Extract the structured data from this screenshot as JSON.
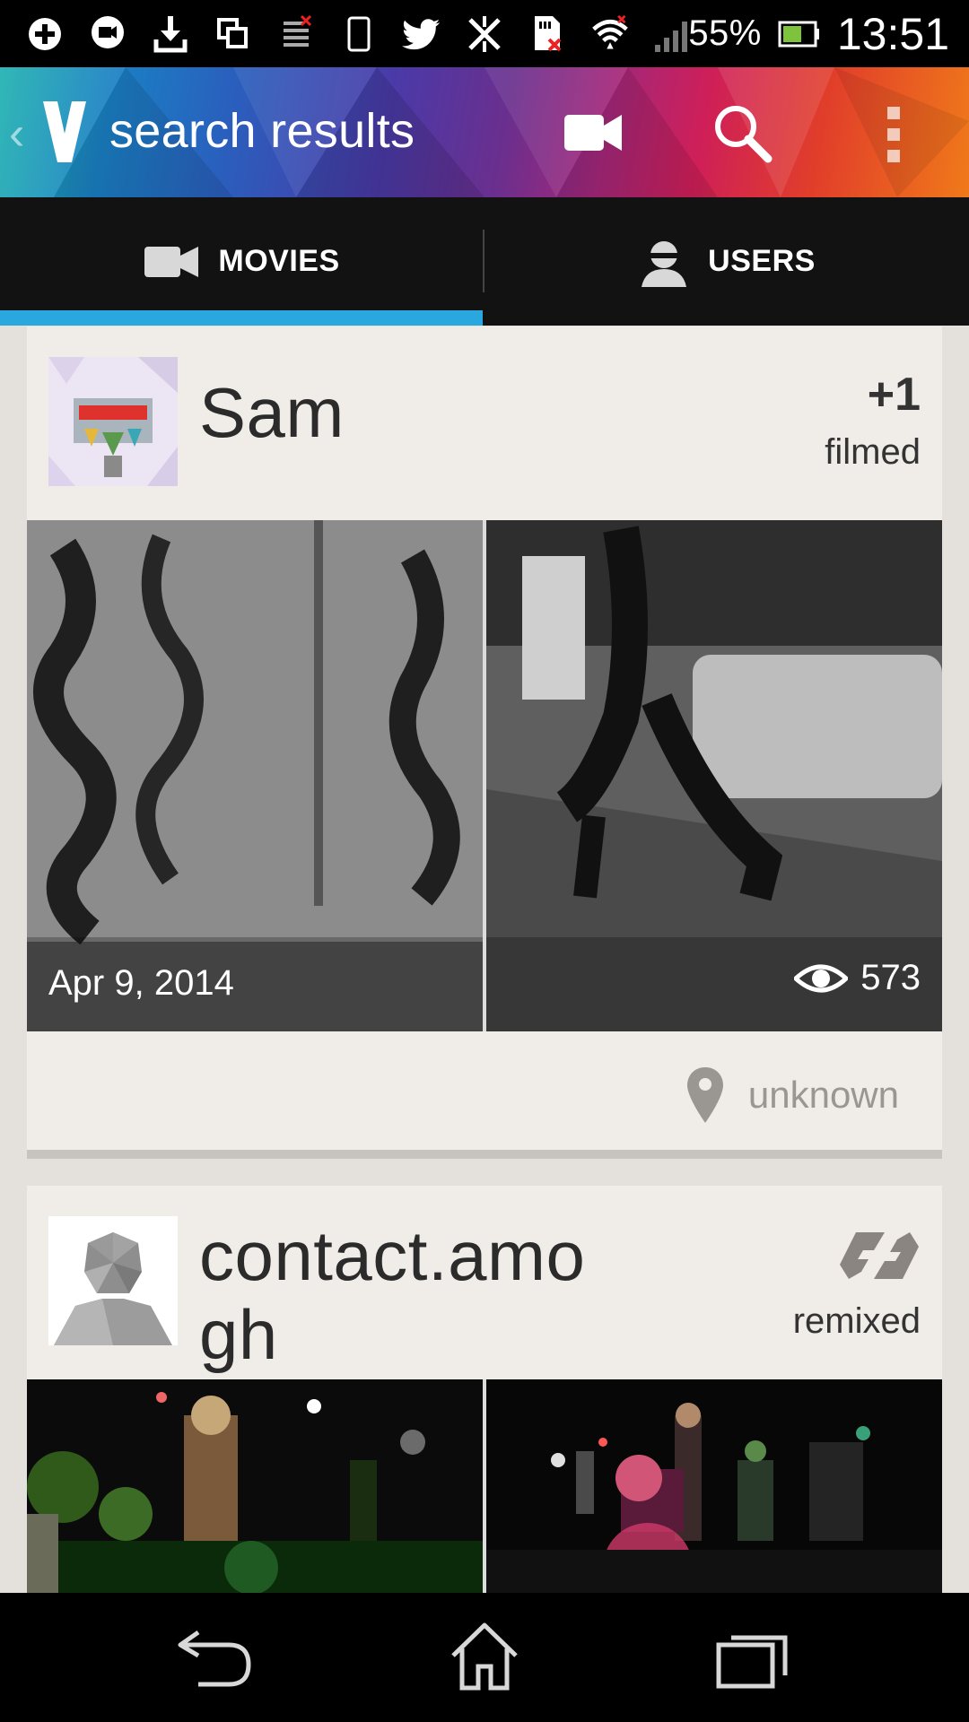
{
  "status_bar": {
    "icons": [
      "add-box-icon",
      "message-icon",
      "download-icon",
      "copy-icon",
      "sim-off-icon",
      "phone-outline-icon",
      "twitter-icon",
      "data-off-icon",
      "sd-card-error-icon",
      "wifi-icon",
      "signal-icon"
    ],
    "battery_pct": "55%",
    "time": "13:51"
  },
  "action_bar": {
    "title": "search results",
    "icons": [
      "back-icon",
      "app-logo",
      "video-camera-icon",
      "search-icon",
      "overflow-menu-icon"
    ]
  },
  "tabs": [
    {
      "label": "MOVIES",
      "icon": "video-camera-icon",
      "selected": true
    },
    {
      "label": "USERS",
      "icon": "user-icon",
      "selected": false
    }
  ],
  "accent_color": "#2aa7de",
  "results": [
    {
      "user": "Sam",
      "stat_top": "+1",
      "stat_label": "filmed",
      "date": "Apr 9, 2014",
      "views": "573",
      "location": "unknown"
    },
    {
      "user_line1": "contact.amo",
      "user_line2": "gh",
      "stat_label": "remixed",
      "stat_icon": "remix-icon"
    }
  ],
  "nav_bar": [
    "back-icon",
    "home-icon",
    "recent-apps-icon"
  ]
}
